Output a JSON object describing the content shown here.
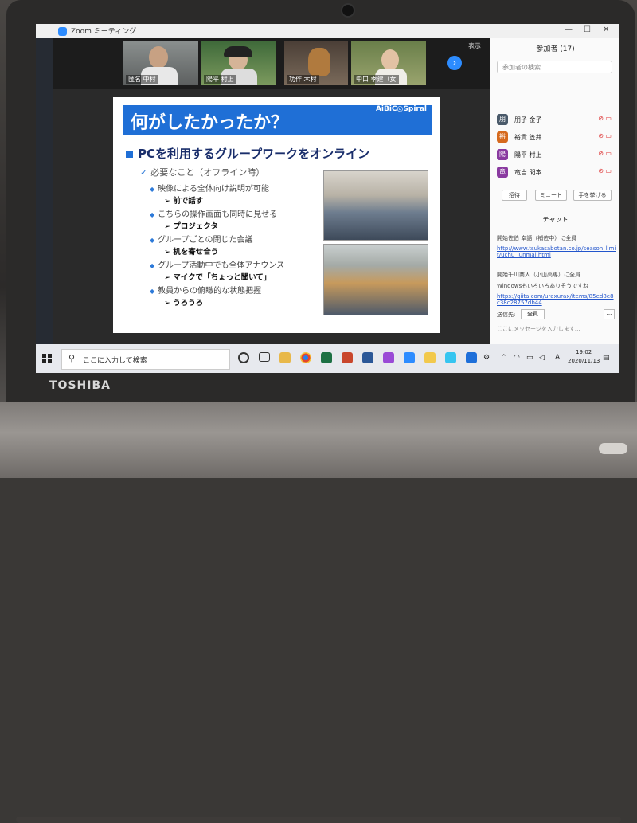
{
  "zoom": {
    "window_title": "Zoom ミーティング",
    "show_label": "表示",
    "next_arrow": "›",
    "participants_videos": [
      {
        "label": "匿名 中村"
      },
      {
        "label": "陽平 村上"
      },
      {
        "label": "功作 木村"
      },
      {
        "label": "中口 季建（女"
      }
    ]
  },
  "slide": {
    "title": "何がしたかったか？",
    "logo": "AiBiC◎Spiral",
    "main_bullet": "PCを利用するグループワークをオンライン",
    "sub_bullet": "必要なこと（オフライン時）",
    "items": [
      {
        "text": "映像による全体向け説明が可能",
        "sub": "前で話す"
      },
      {
        "text": "こちらの操作画面も同時に見せる",
        "sub": "プロジェクタ"
      },
      {
        "text": "グループごとの閉じた会議",
        "sub": "机を寄せ合う"
      },
      {
        "text": "グループ活動中でも全体アナウンス",
        "sub": "マイクで「ちょっと聞いて」"
      },
      {
        "text": "教員からの俯瞰的な状態把握",
        "sub": "うろうろ"
      }
    ]
  },
  "panel": {
    "participants_header": "参加者 (17)",
    "search_placeholder": "参加者の検索",
    "participants": [
      {
        "initial": "朋",
        "name": "朋子 金子",
        "color": "#4a5a6a"
      },
      {
        "initial": "裕",
        "name": "裕貴 笠井",
        "color": "#d66a1e"
      },
      {
        "initial": "陽",
        "name": "陽平 村上",
        "color": "#8a3aa0"
      },
      {
        "initial": "竜",
        "name": "竜吉 間本",
        "color": "#8a3aa0"
      }
    ],
    "buttons": [
      "招待",
      "ミュート",
      "手を挙げる"
    ],
    "chat_header": "チャット",
    "chat": [
      {
        "from": "開始佐伯 幸語（補佐中）に全員",
        "link": "http://www.tsukasabotan.co.jp/season_limit/uchu_junmai.html"
      },
      {
        "from": "開始千川商人（小山高専）に全員",
        "text": "Windowsもいろいろありそうですね",
        "link": "https://qiita.com/uraxurax/items/85ed8e8c38c28757db44"
      }
    ],
    "send_to_label": "送信先:",
    "send_to_value": "全員",
    "more": "...",
    "input_placeholder": "ここにメッセージを入力します..."
  },
  "taskbar": {
    "search_placeholder": "ここに入力して検索",
    "time": "19:02",
    "date": "2020/11/13",
    "ime": "A"
  },
  "laptop": {
    "brand": "TOSHIBA"
  }
}
